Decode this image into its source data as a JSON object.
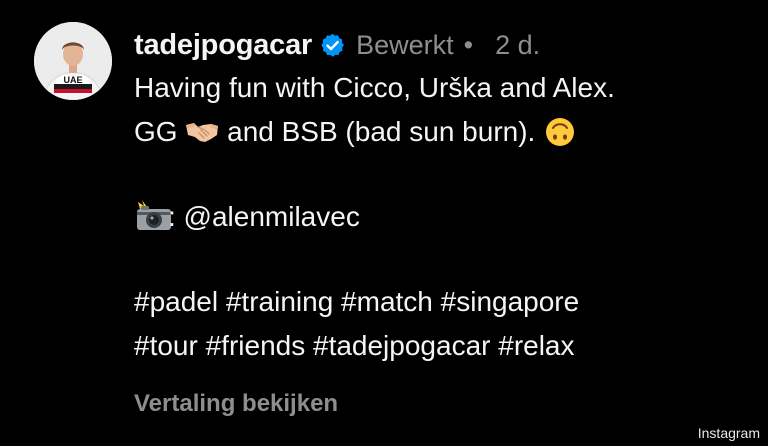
{
  "post": {
    "username": "tadejpogacar",
    "edited_label": "Bewerkt",
    "separator": "•",
    "time": "2 d.",
    "caption": {
      "line1": "Having fun with Cicco, Urška and Alex.",
      "line2_start": "GG ",
      "line2_mid": " and BSB (bad sun burn). ",
      "line4_mention": ": @alenmilavec",
      "line6": "#padel #training #match #singapore",
      "line7": "#tour #friends #tadejpogacar #relax"
    },
    "translate_label": "Vertaling bekijken",
    "avatar_jersey_text": "UAE",
    "icons": {
      "verified": "verified-badge-icon",
      "handshake": "handshake-emoji",
      "upside_down": "upside-down-face-emoji",
      "camera": "camera-with-flash-emoji"
    },
    "colors": {
      "verified_blue": "#0095f6",
      "muted_text": "#8e8e8e",
      "text": "#f5f5f5",
      "background": "#000000"
    }
  },
  "watermark": "Instagram"
}
